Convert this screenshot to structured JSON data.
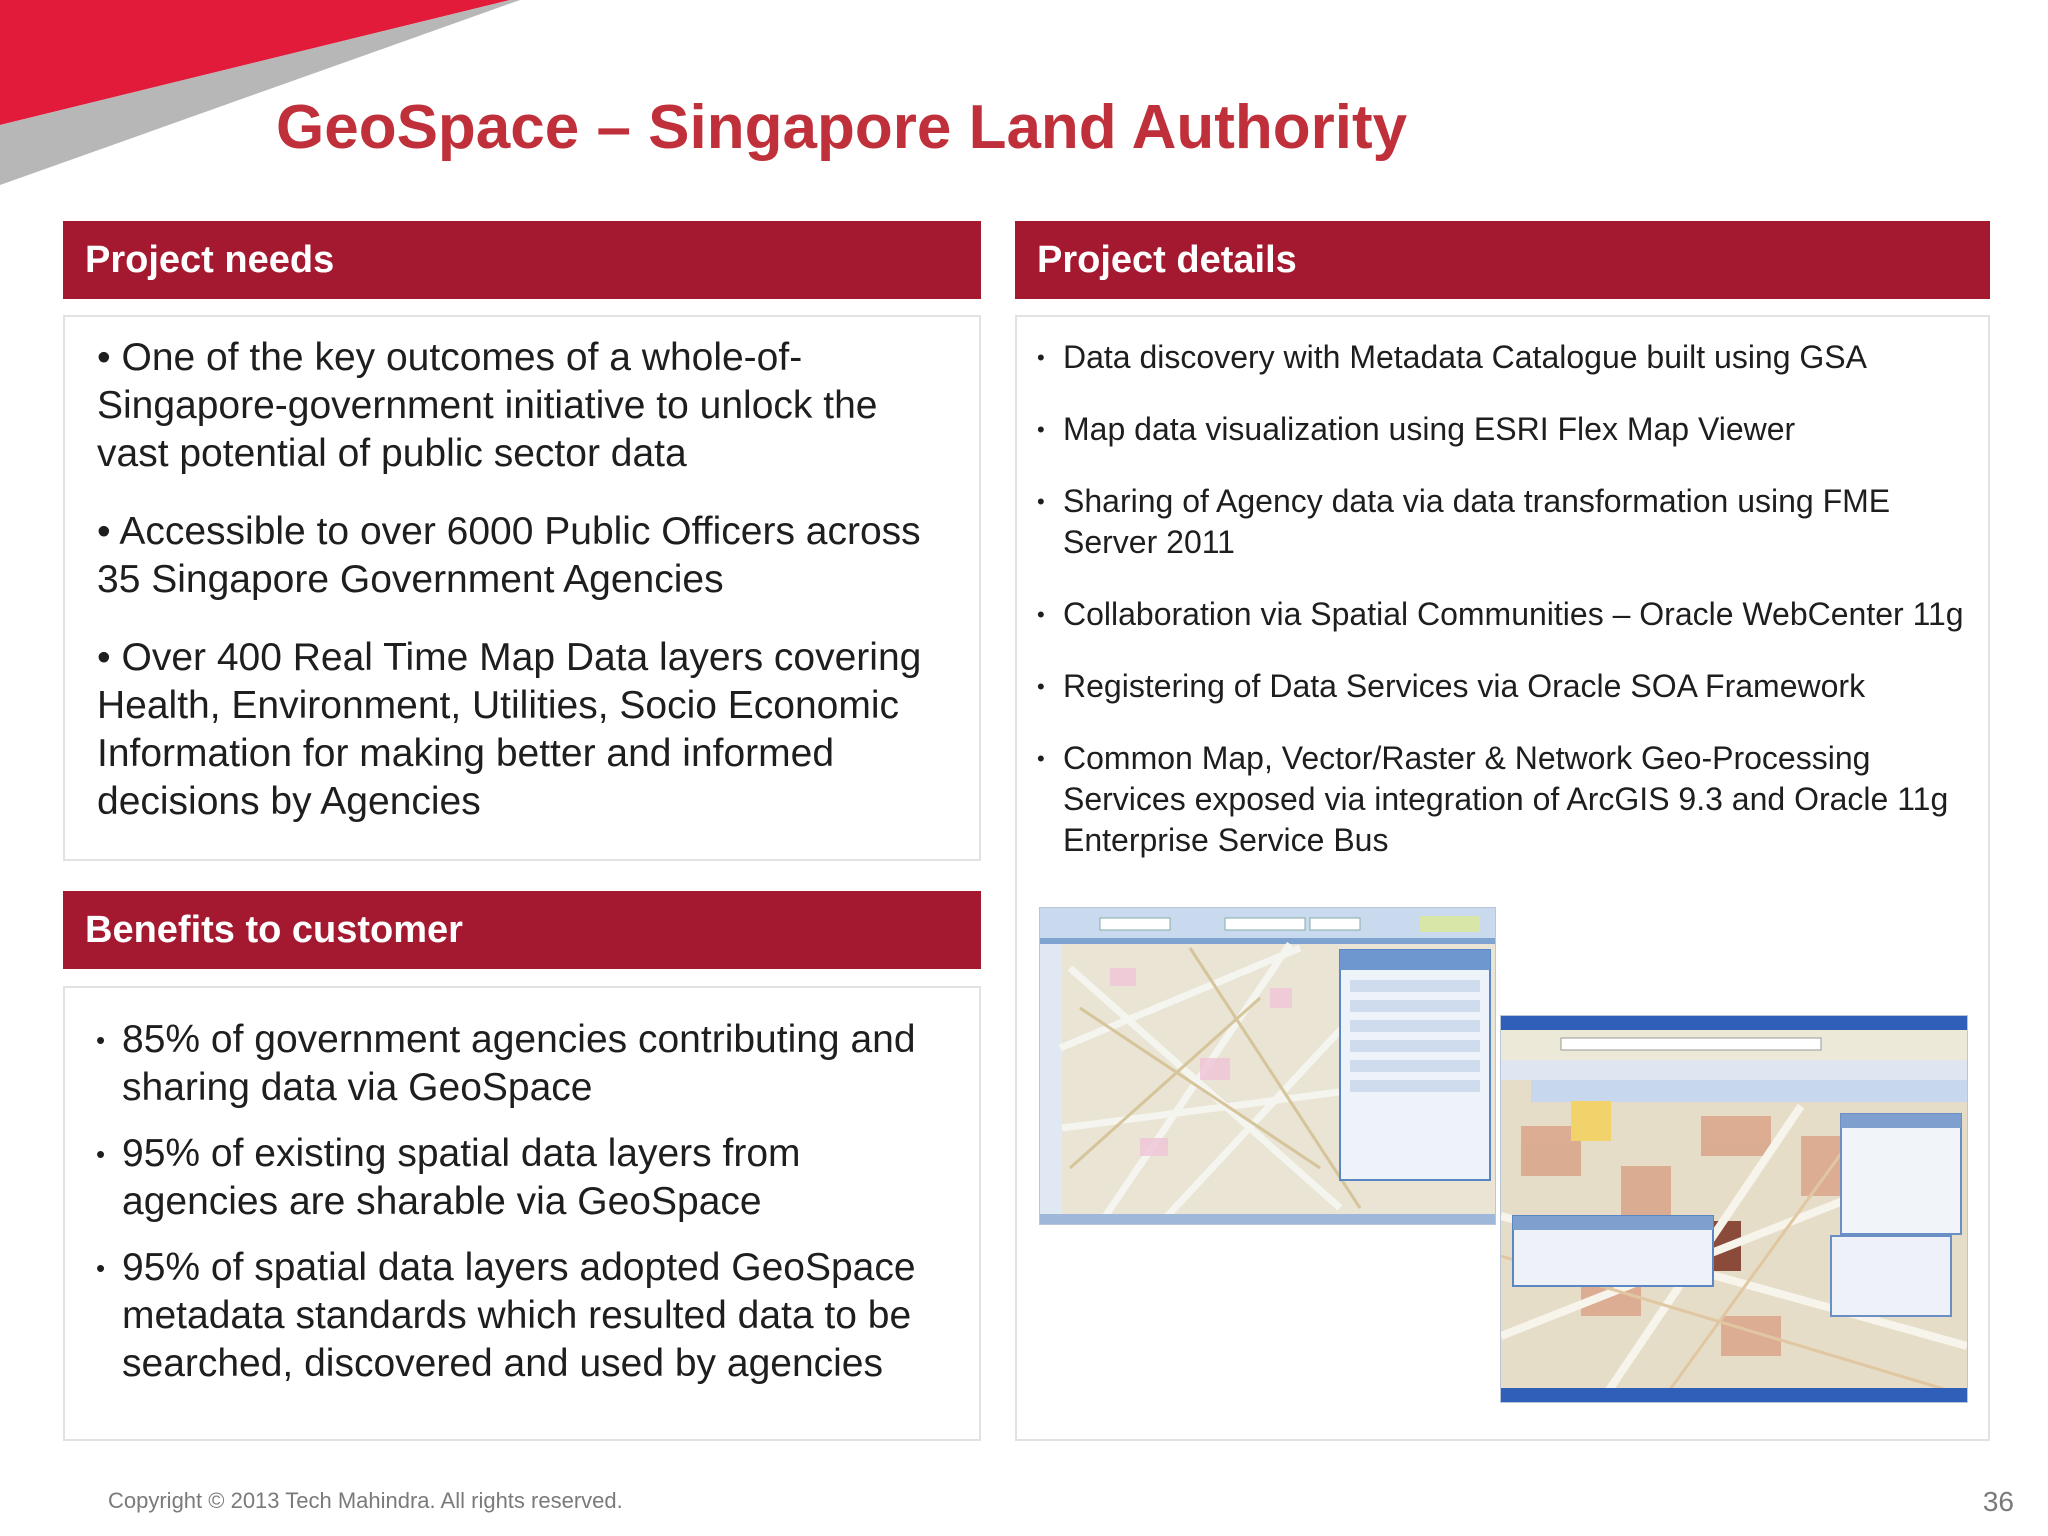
{
  "slide": {
    "title": "GeoSpace – Singapore Land Authority",
    "page_number": "36",
    "footer": "Copyright © 2013 Tech Mahindra. All rights reserved."
  },
  "needs": {
    "header": "Project needs",
    "items": [
      "• One of the key outcomes of a whole-of-Singapore-government initiative to unlock the vast potential of public sector data",
      "• Accessible to over  6000 Public Officers across 35 Singapore Government Agencies",
      "• Over 400 Real Time Map Data layers covering Health, Environment, Utilities, Socio Economic Information for making better and informed decisions by Agencies"
    ]
  },
  "benefits": {
    "header": "Benefits to customer",
    "items": [
      " 85% of government agencies contributing and sharing data via GeoSpace",
      "95% of existing spatial data layers from agencies are sharable via GeoSpace",
      "95% of spatial data layers adopted GeoSpace metadata standards which resulted data to be searched, discovered and used by agencies"
    ]
  },
  "details": {
    "header": "Project details",
    "items": [
      " Data discovery with Metadata Catalogue built using GSA",
      "Map data visualization using ESRI Flex Map Viewer",
      "Sharing of Agency data via data transformation using FME Server 2011",
      "Collaboration via Spatial Communities – Oracle WebCenter 11g",
      "Registering of Data Services via Oracle SOA Framework",
      "Common Map, Vector/Raster & Network Geo-Processing Services exposed via integration of ArcGIS 9.3 and Oracle 11g Enterprise Service Bus"
    ]
  },
  "colors": {
    "accent": "#a51930",
    "title": "#c0303b",
    "corner_red": "#e31b3a",
    "corner_grey": "#b0b0b0"
  },
  "bullet_symbol": "•"
}
